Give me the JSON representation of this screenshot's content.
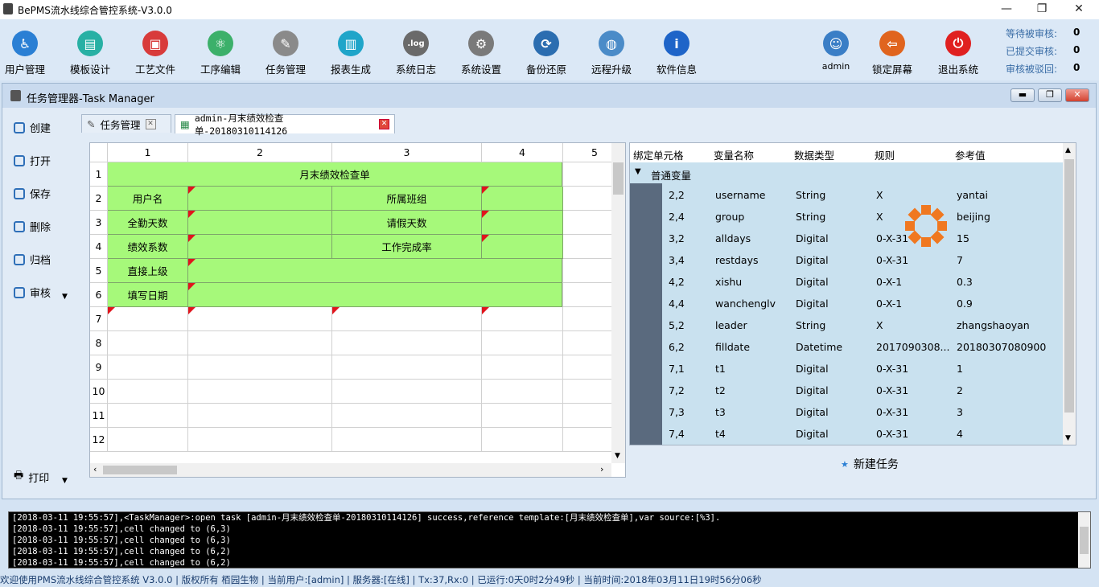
{
  "window": {
    "title": "BePMS流水线综合管控系统-V3.0.0",
    "min": "—",
    "max": "❐",
    "close": "✕"
  },
  "toolbar": {
    "items": [
      {
        "label": "用户管理",
        "icon": "user-manage-icon",
        "color": "#2a7fd4",
        "glyph": "♿"
      },
      {
        "label": "模板设计",
        "icon": "template-design-icon",
        "color": "#28b0a4",
        "glyph": "▤"
      },
      {
        "label": "工艺文件",
        "icon": "pdf-file-icon",
        "color": "#d83b3b",
        "glyph": "▣"
      },
      {
        "label": "工序编辑",
        "icon": "atom-icon",
        "color": "#3cb06a",
        "glyph": "⚛"
      },
      {
        "label": "任务管理",
        "icon": "task-list-icon",
        "color": "#8a8a8a",
        "glyph": "✎"
      },
      {
        "label": "报表生成",
        "icon": "report-icon",
        "color": "#1fa5c9",
        "glyph": "▥"
      },
      {
        "label": "系统日志",
        "icon": "log-icon",
        "color": "#6a6a6a",
        "glyph": ".log"
      },
      {
        "label": "系统设置",
        "icon": "gear-icon",
        "color": "#7a7a7a",
        "glyph": "⚙"
      },
      {
        "label": "备份还原",
        "icon": "backup-icon",
        "color": "#2b6db0",
        "glyph": "⟳"
      },
      {
        "label": "远程升级",
        "icon": "globe-icon",
        "color": "#4a8bc8",
        "glyph": "◍"
      },
      {
        "label": "软件信息",
        "icon": "info-icon",
        "color": "#1e64c8",
        "glyph": "i"
      }
    ],
    "right": [
      {
        "label": "admin",
        "icon": "admin-avatar-icon",
        "color": "#3a7ec6",
        "glyph": "☺"
      },
      {
        "label": "锁定屏幕",
        "icon": "lock-screen-icon",
        "color": "#e0641e",
        "glyph": "⇦"
      },
      {
        "label": "退出系统",
        "icon": "power-icon",
        "color": "#e02020",
        "glyph": "⏻"
      }
    ]
  },
  "stats": [
    {
      "label": "等待被审核:",
      "value": "0"
    },
    {
      "label": "已提交审核:",
      "value": "0"
    },
    {
      "label": "审核被驳回:",
      "value": "0"
    }
  ],
  "taskwin": {
    "title": "任务管理器-Task Manager"
  },
  "sidebar": [
    {
      "label": "创建",
      "icon": "create-icon"
    },
    {
      "label": "打开",
      "icon": "open-icon"
    },
    {
      "label": "保存",
      "icon": "save-icon"
    },
    {
      "label": "删除",
      "icon": "delete-icon"
    },
    {
      "label": "归档",
      "icon": "archive-icon"
    },
    {
      "label": "审核",
      "icon": "review-icon"
    }
  ],
  "print": "打印",
  "tabs": [
    {
      "label": "任务管理"
    },
    {
      "label": "admin-月末绩效检查单-20180310114126"
    }
  ],
  "grid": {
    "cols": [
      "1",
      "2",
      "3",
      "4",
      "5"
    ],
    "rows": [
      "1",
      "2",
      "3",
      "4",
      "5",
      "6",
      "7",
      "8",
      "9",
      "10",
      "11",
      "12"
    ],
    "title": "月末绩效检查单",
    "cells": {
      "r2c1": "用户名",
      "r2c3": "所属班组",
      "r3c1": "全勤天数",
      "r3c3": "请假天数",
      "r4c1": "绩效系数",
      "r4c3": "工作完成率",
      "r5c1": "直接上级",
      "r6c1": "填写日期"
    }
  },
  "vartable": {
    "headers": [
      "绑定单元格",
      "变量名称",
      "数据类型",
      "规则",
      "参考值"
    ],
    "group": "普通变量",
    "rows": [
      [
        "2,2",
        "username",
        "String",
        "X",
        "yantai"
      ],
      [
        "2,4",
        "group",
        "String",
        "X",
        "beijing"
      ],
      [
        "3,2",
        "alldays",
        "Digital",
        "0-X-31",
        "15"
      ],
      [
        "3,4",
        "restdays",
        "Digital",
        "0-X-31",
        "7"
      ],
      [
        "4,2",
        "xishu",
        "Digital",
        "0-X-1",
        "0.3"
      ],
      [
        "4,4",
        "wanchenglv",
        "Digital",
        "0-X-1",
        "0.9"
      ],
      [
        "5,2",
        "leader",
        "String",
        "X",
        "zhangshaoyan"
      ],
      [
        "6,2",
        "filldate",
        "Datetime",
        "2017090308...",
        "20180307080900"
      ],
      [
        "7,1",
        "t1",
        "Digital",
        "0-X-31",
        "1"
      ],
      [
        "7,2",
        "t2",
        "Digital",
        "0-X-31",
        "2"
      ],
      [
        "7,3",
        "t3",
        "Digital",
        "0-X-31",
        "3"
      ],
      [
        "7,4",
        "t4",
        "Digital",
        "0-X-31",
        "4"
      ]
    ]
  },
  "new_task": "新建任务",
  "log": [
    "[2018-03-11 19:55:57],<TaskManager>:open task [admin-月末绩效检查单-20180310114126] success,reference template:[月末绩效检查单],var source:[%3].",
    "[2018-03-11 19:55:57],cell changed to (6,3)",
    "[2018-03-11 19:55:57],cell changed to (6,3)",
    "[2018-03-11 19:55:57],cell changed to (6,2)",
    "[2018-03-11 19:55:57],cell changed to (6,2)"
  ],
  "status": "欢迎使用PMS流水线综合管控系统 V3.0.0 | 版权所有 栢园生物 | 当前用户:[admin] | 服务器:[在线] | Tx:37,Rx:0 | 已运行:0天0时2分49秒 | 当前时间:2018年03月11日19时56分06秒"
}
